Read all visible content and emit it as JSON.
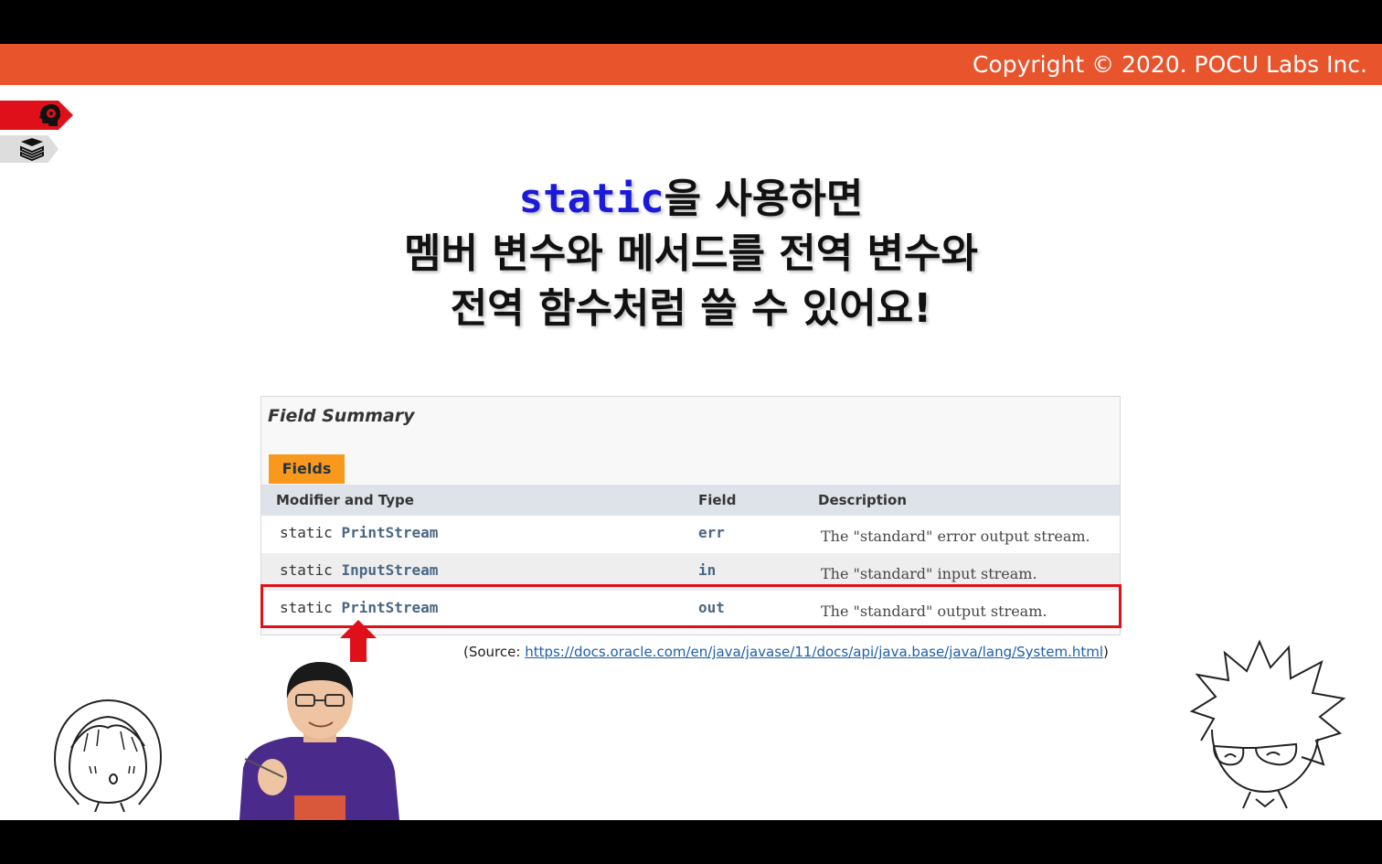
{
  "header": {
    "copyright": "Copyright © 2020. POCU Labs Inc."
  },
  "nav_icons": [
    "brain-head-icon",
    "book-stack-icon"
  ],
  "headline": {
    "keyword": "static",
    "line1_rest": "을 사용하면",
    "line2": "멤버 변수와 메서드를 전역 변수와",
    "line3": "전역 함수처럼 쓸 수 있어요!"
  },
  "doc": {
    "title": "Field Summary",
    "tab_label": "Fields",
    "columns": [
      "Modifier and Type",
      "Field",
      "Description"
    ],
    "rows": [
      {
        "modifier": "static",
        "type": "PrintStream",
        "field": "err",
        "description": "The \"standard\" error output stream."
      },
      {
        "modifier": "static",
        "type": "InputStream",
        "field": "in",
        "description": "The \"standard\" input stream."
      },
      {
        "modifier": "static",
        "type": "PrintStream",
        "field": "out",
        "description": "The \"standard\" output stream."
      }
    ]
  },
  "source": {
    "prefix": "(Source: ",
    "url": "https://docs.oracle.com/en/java/javase/11/docs/api/java.base/java/lang/System.html",
    "suffix": ")"
  },
  "colors": {
    "header": "#e8542c",
    "highlight": "#e0101a",
    "keyword": "#1a1ad8",
    "fields_tab": "#f8981d"
  }
}
